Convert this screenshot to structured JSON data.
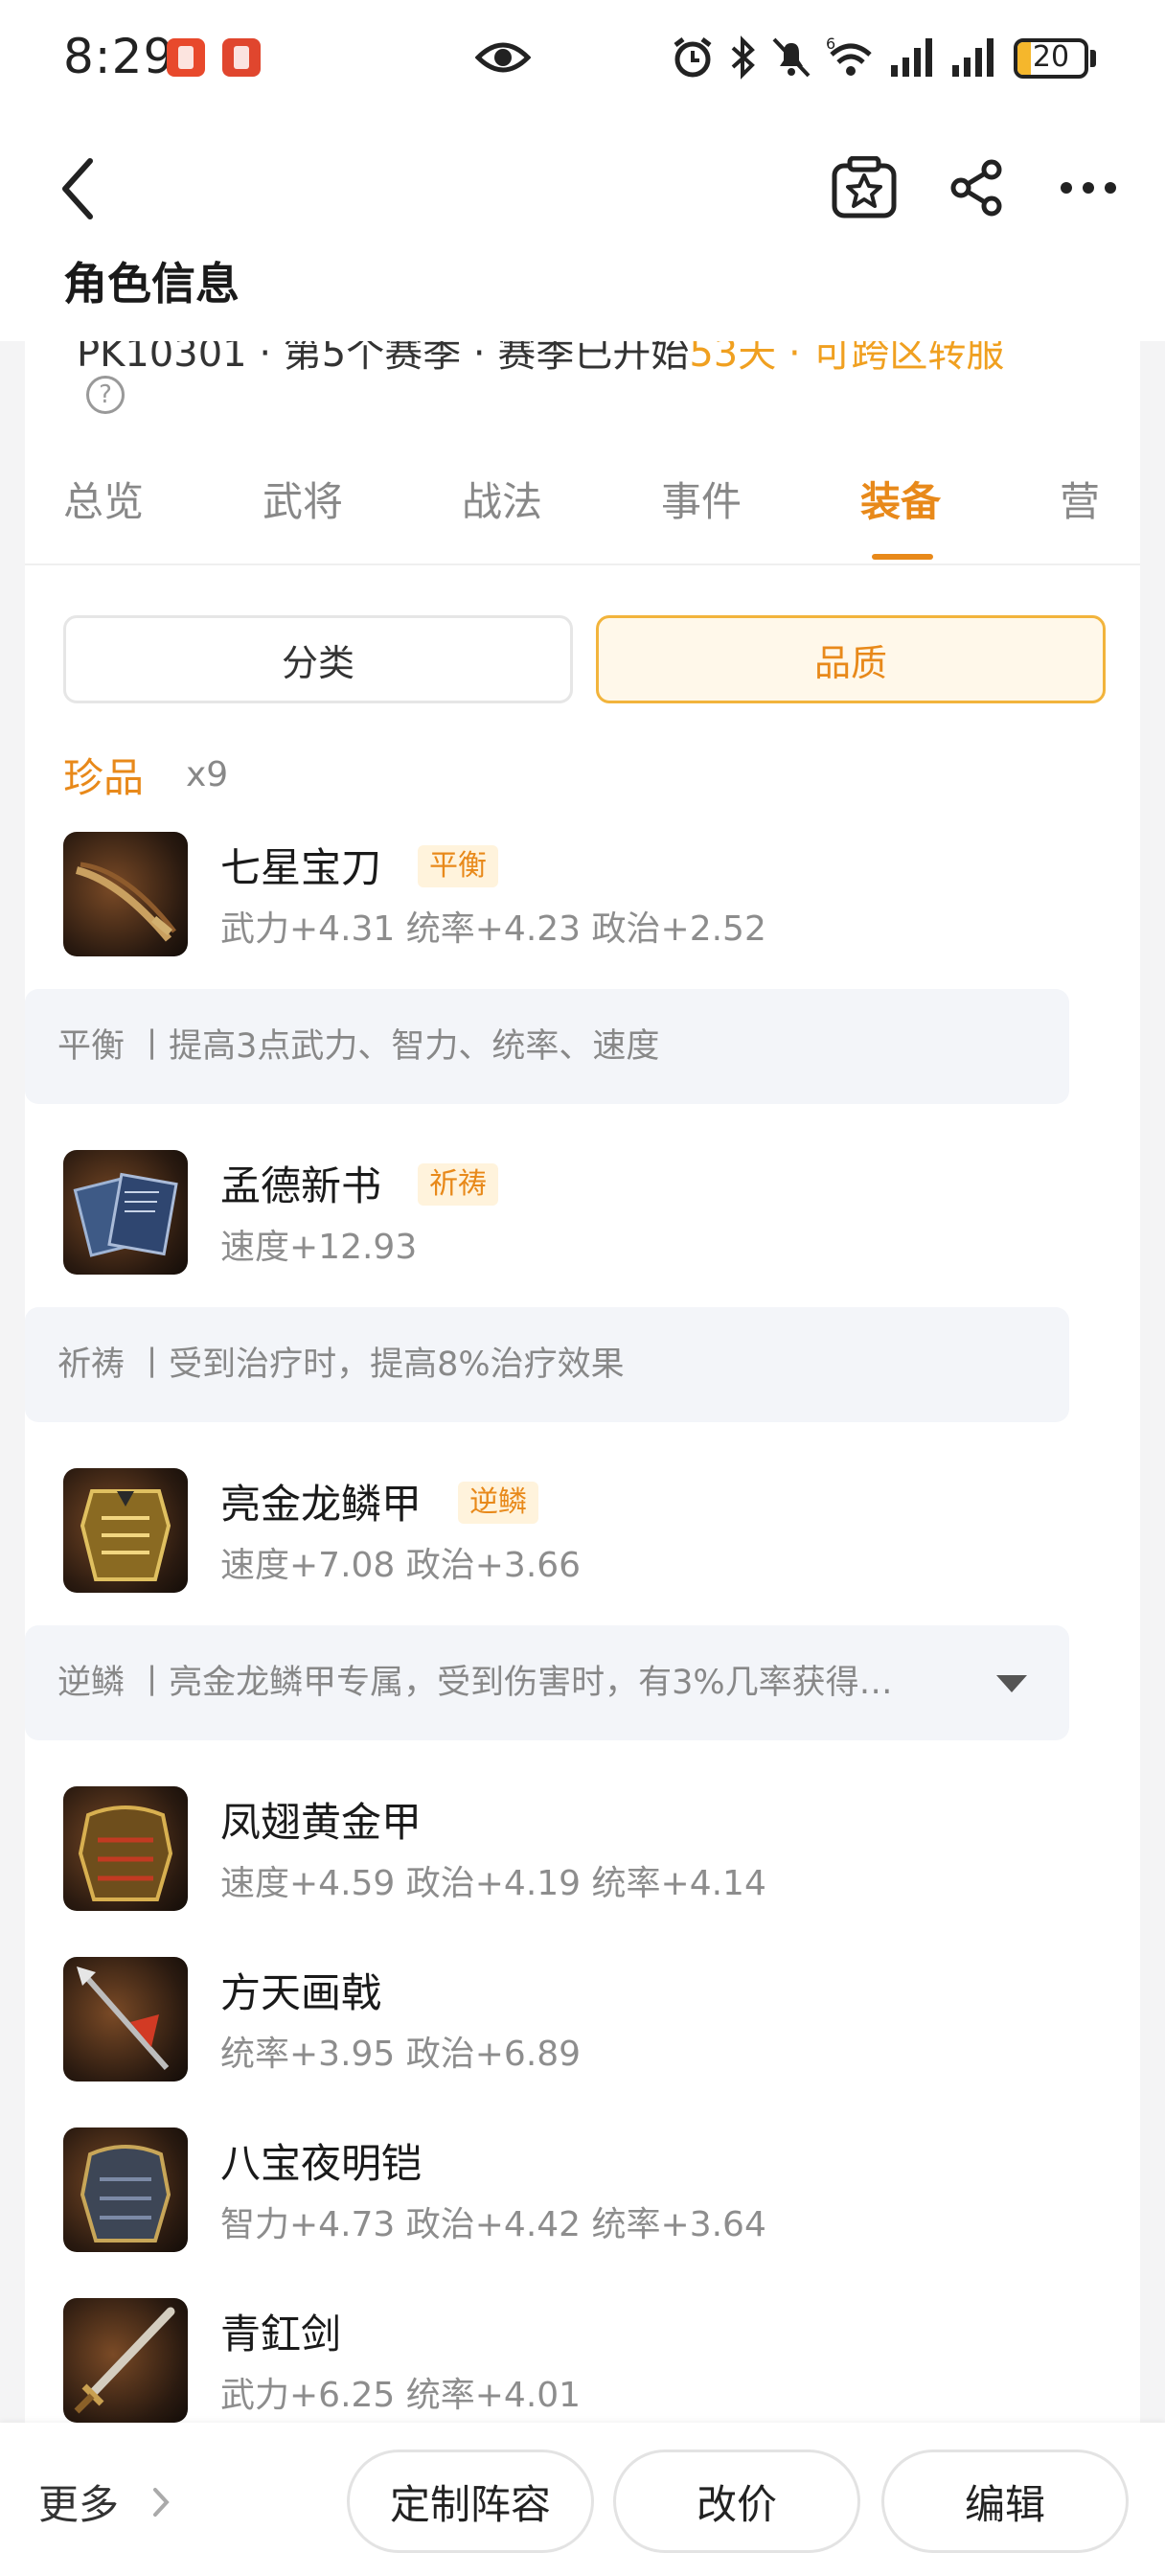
{
  "status_bar": {
    "time": "8:29",
    "battery": "20",
    "battery_level": 0.2,
    "network_badge": "6",
    "icons": [
      "notification-app-icon",
      "notification-app-icon",
      "eye-icon",
      "alarm-icon",
      "bluetooth-icon",
      "mute-icon",
      "wifi-icon",
      "signal-icon",
      "signal-icon",
      "battery-icon"
    ]
  },
  "header": {
    "title": "角色信息",
    "icons": [
      "back-icon",
      "favorite-star-icon",
      "share-icon",
      "more-dots-icon"
    ]
  },
  "profile_partial": {
    "text_prefix": "PK10301 · 第5个赛季 · 赛季已开始",
    "text_highlight": "53天 · 可跨区转服",
    "help_glyph": "?"
  },
  "tabs": [
    "总览",
    "武将",
    "战法",
    "事件",
    "装备",
    "营"
  ],
  "active_tab_index": 4,
  "segments": {
    "left": "分类",
    "right": "品质",
    "selected": "right"
  },
  "section": {
    "title": "珍品",
    "count": "x9"
  },
  "items": [
    {
      "name": "七星宝刀",
      "tag": "平衡",
      "stats": "武力+4.31 统率+4.23 政治+2.52",
      "desc": "平衡 丨提高3点武力、智力、统率、速度",
      "expandable": false
    },
    {
      "name": "孟德新书",
      "tag": "祈祷",
      "stats": "速度+12.93",
      "desc": "祈祷 丨受到治疗时，提高8%治疗效果",
      "expandable": false
    },
    {
      "name": "亮金龙鳞甲",
      "tag": "逆鳞",
      "stats": "速度+7.08 政治+3.66",
      "desc": "逆鳞 丨亮金龙鳞甲专属，受到伤害时，有3%几率获得…",
      "expandable": true
    },
    {
      "name": "凤翅黄金甲",
      "stats": "速度+4.59 政治+4.19 统率+4.14"
    },
    {
      "name": "方天画戟",
      "stats": "统率+3.95 政治+6.89"
    },
    {
      "name": "八宝夜明铠",
      "stats": "智力+4.73 政治+4.42 统率+3.64"
    },
    {
      "name": "青釭剑",
      "stats": "武力+6.25 统率+4.01"
    }
  ],
  "bottom_bar": {
    "more_label": "更多",
    "buttons": [
      "定制阵容",
      "改价",
      "编辑"
    ]
  },
  "colors": {
    "accent": "#e8891a",
    "tag_bg": "#fff3dc",
    "desc_bg": "#f3f5f9",
    "page_bg": "#f4f4f5"
  }
}
